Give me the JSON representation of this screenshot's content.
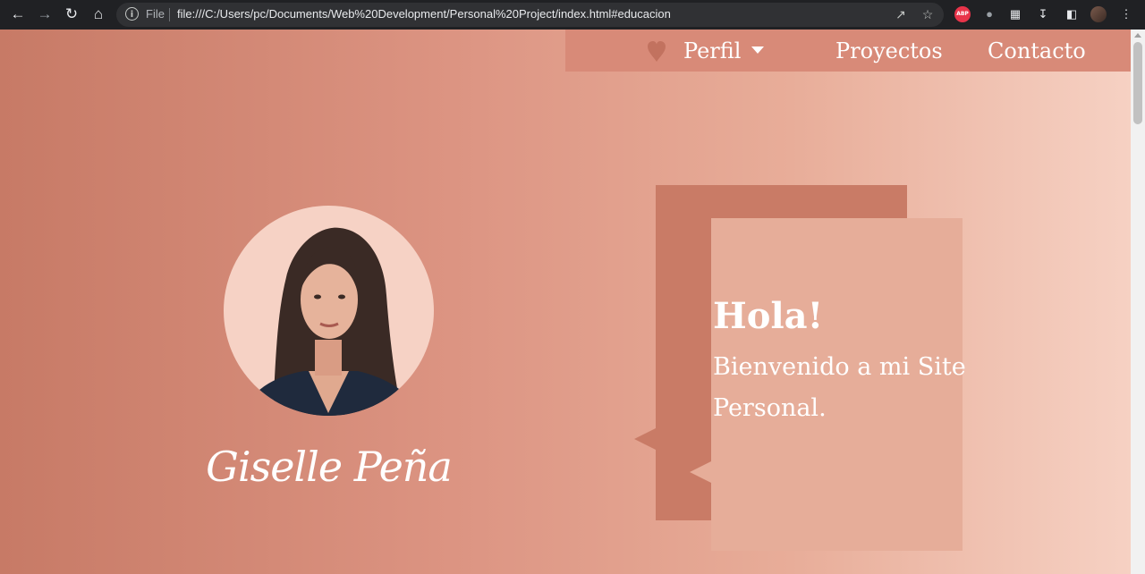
{
  "browser": {
    "scheme": "File",
    "url": "file:///C:/Users/pc/Documents/Web%20Development/Personal%20Project/index.html#educacion",
    "icons": [
      "back-icon",
      "forward-icon",
      "reload-icon",
      "home-icon",
      "info-icon",
      "share-icon",
      "bookmark-star-icon",
      "adblock-icon",
      "extension-icon",
      "puzzle-icon",
      "download-icon",
      "sidepanel-icon",
      "profile-avatar",
      "menu-icon"
    ],
    "adblock_label": "ABP"
  },
  "nav": {
    "items": [
      {
        "label": "Perfil",
        "has_dropdown": true
      },
      {
        "label": "Proyectos"
      },
      {
        "label": "Contacto"
      }
    ],
    "heart_icon": "heart-icon"
  },
  "profile": {
    "name": "Giselle Peña"
  },
  "greeting": {
    "title": "Hola!",
    "subtitle": "Bienvenido a mi Site Personal."
  },
  "colors": {
    "nav_bg": "#d88a78",
    "bubble_dark": "#c97b66",
    "bubble_light": "#e6ad99",
    "gradient_start": "#c77a66",
    "gradient_end": "#f6d1c3"
  }
}
